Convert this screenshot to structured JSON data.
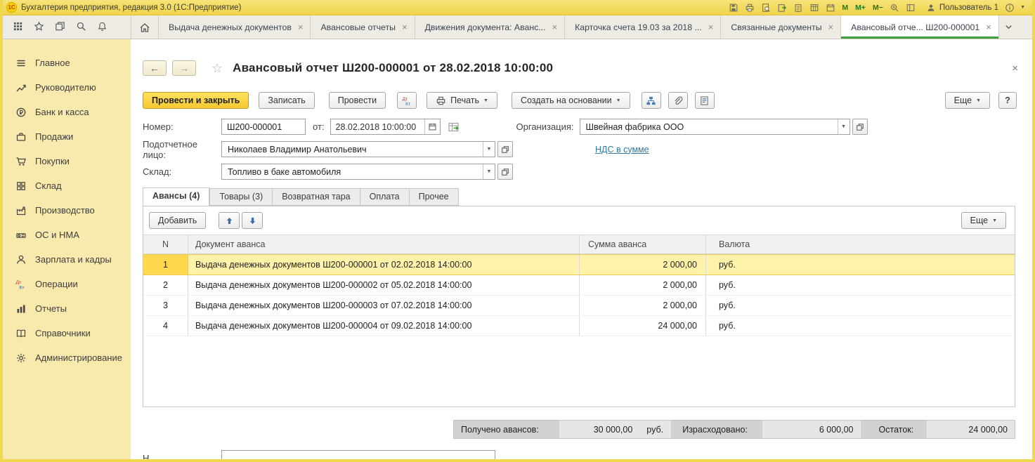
{
  "window": {
    "logo": "1С",
    "title": "Бухгалтерия предприятия, редакция 3.0 (1С:Предприятие)",
    "memory_buttons": [
      "М",
      "М+",
      "М−"
    ],
    "user": "Пользователь 1"
  },
  "glyphs": {
    "close": "×",
    "caret": "▼",
    "back": "←",
    "forward": "→",
    "star": "☆"
  },
  "tabbar": {
    "tabs": [
      {
        "label": "Выдача денежных документов"
      },
      {
        "label": "Авансовые отчеты"
      },
      {
        "label": "Движения документа: Аванс..."
      },
      {
        "label": "Карточка счета 19.03 за 2018 ..."
      },
      {
        "label": "Связанные документы"
      },
      {
        "label": "Авансовый отче... Ш200-000001"
      }
    ]
  },
  "sidebar": {
    "items": [
      {
        "label": "Главное"
      },
      {
        "label": "Руководителю"
      },
      {
        "label": "Банк и касса"
      },
      {
        "label": "Продажи"
      },
      {
        "label": "Покупки"
      },
      {
        "label": "Склад"
      },
      {
        "label": "Производство"
      },
      {
        "label": "ОС и НМА"
      },
      {
        "label": "Зарплата и кадры"
      },
      {
        "label": "Операции"
      },
      {
        "label": "Отчеты"
      },
      {
        "label": "Справочники"
      },
      {
        "label": "Администрирование"
      }
    ]
  },
  "doc": {
    "title": "Авансовый отчет Ш200-000001 от 28.02.2018 10:00:00",
    "commands": {
      "post_and_close": "Провести и закрыть",
      "write": "Записать",
      "post": "Провести",
      "print": "Печать",
      "create_on_base": "Создать на основании",
      "more": "Еще",
      "help": "?"
    },
    "fields": {
      "number_label": "Номер:",
      "number": "Ш200-000001",
      "date_label": "от:",
      "date": "28.02.2018 10:00:00",
      "org_label": "Организация:",
      "org": "Швейная фабрика ООО",
      "person_label": "Подотчетное лицо:",
      "person": "Николаев Владимир Анатольевич",
      "vat_link": "НДС в сумме",
      "warehouse_label": "Склад:",
      "warehouse": "Топливо в баке автомобиля"
    },
    "page_tabs": [
      "Авансы (4)",
      "Товары (3)",
      "Возвратная тара",
      "Оплата",
      "Прочее"
    ],
    "grid_toolbar": {
      "add": "Добавить",
      "more": "Еще"
    },
    "grid": {
      "columns": [
        "N",
        "Документ аванса",
        "Сумма аванса",
        "Валюта"
      ],
      "rows": [
        {
          "n": "1",
          "doc": "Выдача денежных документов Ш200-000001 от 02.02.2018 14:00:00",
          "amount": "2 000,00",
          "currency": "руб."
        },
        {
          "n": "2",
          "doc": "Выдача денежных документов Ш200-000002 от 05.02.2018 14:00:00",
          "amount": "2 000,00",
          "currency": "руб."
        },
        {
          "n": "3",
          "doc": "Выдача денежных документов Ш200-000003 от 07.02.2018 14:00:00",
          "amount": "2 000,00",
          "currency": "руб."
        },
        {
          "n": "4",
          "doc": "Выдача денежных документов Ш200-000004 от 09.02.2018 14:00:00",
          "amount": "24 000,00",
          "currency": "руб."
        }
      ]
    },
    "totals": {
      "received_label": "Получено авансов:",
      "received": "30 000,00",
      "received_currency": "руб.",
      "spent_label": "Израсходовано:",
      "spent": "6 000,00",
      "rest_label": "Остаток:",
      "rest": "24 000,00"
    },
    "bottom_partial_label": "Н"
  }
}
